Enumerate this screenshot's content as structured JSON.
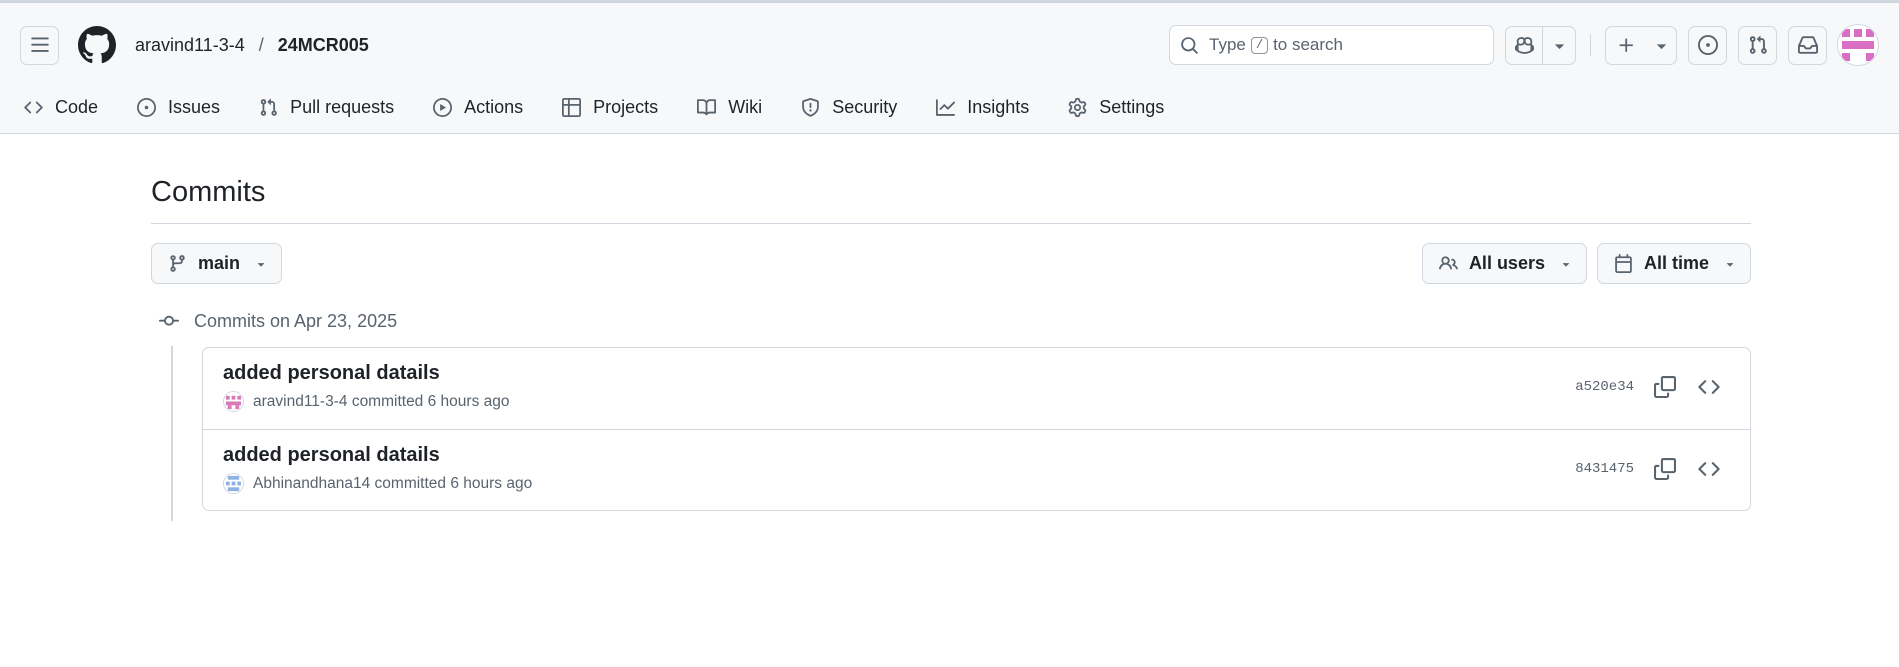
{
  "header": {
    "owner": "aravind11-3-4",
    "separator": "/",
    "repo": "24MCR005",
    "search": {
      "prefix": "Type",
      "key": "/",
      "suffix": "to search"
    }
  },
  "nav": {
    "items": [
      {
        "label": "Code",
        "icon": "code-icon"
      },
      {
        "label": "Issues",
        "icon": "issue-icon"
      },
      {
        "label": "Pull requests",
        "icon": "pull-request-icon"
      },
      {
        "label": "Actions",
        "icon": "play-icon"
      },
      {
        "label": "Projects",
        "icon": "table-icon"
      },
      {
        "label": "Wiki",
        "icon": "book-icon"
      },
      {
        "label": "Security",
        "icon": "shield-icon"
      },
      {
        "label": "Insights",
        "icon": "graph-icon"
      },
      {
        "label": "Settings",
        "icon": "gear-icon"
      }
    ]
  },
  "page": {
    "title": "Commits",
    "branch": "main",
    "users_filter": "All users",
    "time_filter": "All time",
    "group_label": "Commits on Apr 23, 2025"
  },
  "commits": [
    {
      "message": "added personal datails",
      "author": "aravind11-3-4",
      "action": "committed",
      "time": "6 hours ago",
      "sha": "a520e34",
      "avatar_color": "#d97ab8"
    },
    {
      "message": "added personal datails",
      "author": "Abhinandhana14",
      "action": "committed",
      "time": "6 hours ago",
      "sha": "8431475",
      "avatar_color": "#8fb2e0"
    }
  ],
  "colors": {
    "border": "#d0d7de",
    "muted": "#59636e",
    "header_bg": "#f6f8fa",
    "avatar_top": "#d96fc4"
  }
}
